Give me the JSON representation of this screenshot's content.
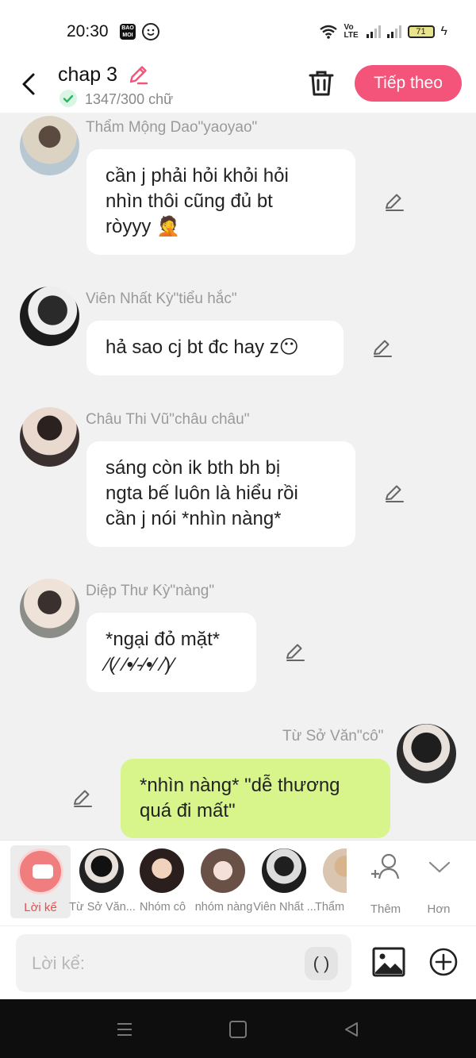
{
  "status_bar": {
    "time": "20:30",
    "battery": "71",
    "baomoi_text": "BAO MOI",
    "volte": "Vo LTE"
  },
  "header": {
    "title": "chap 3",
    "word_count": "1347/300 chữ",
    "next_label": "Tiếp theo",
    "accent_color": "#f4537a"
  },
  "messages": [
    {
      "sender": "Thẩm Mộng Dao\"yaoyao\"",
      "lines": [
        "cần j phải hỏi khỏi hỏi",
        "nhìn thôi cũng đủ bt",
        "ròyyy 🤦"
      ],
      "side": "left"
    },
    {
      "sender": "Viên Nhất Kỳ\"tiểu hắc\"",
      "lines": [
        "hả sao cj bt đc hay z😶"
      ],
      "side": "left"
    },
    {
      "sender": "Châu Thi Vũ\"châu châu\"",
      "lines": [
        "sáng còn ik bth bh bị",
        "ngta bế luôn là hiểu rồi",
        "cần j nói *nhìn nàng*"
      ],
      "side": "left"
    },
    {
      "sender": "Diệp Thư Kỳ\"nàng\"",
      "lines": [
        "*ngại đỏ mặt*",
        "⁄(⁄ ⁄•⁄-⁄•⁄ ⁄)⁄"
      ],
      "side": "left"
    },
    {
      "sender": "Từ Sở Văn\"cô\"",
      "lines": [
        "*nhìn nàng* \"dễ thương",
        "quá đi mất\""
      ],
      "side": "right"
    }
  ],
  "character_bar": {
    "narration_label": "Lời kể",
    "characters": [
      "Từ Sở Văn...",
      "Nhóm cô",
      "nhóm nàng",
      "Viên Nhất ...",
      "Thẩm"
    ],
    "add_label": "Thêm",
    "more_label": "Hơn"
  },
  "input": {
    "placeholder": "Lời kể:",
    "paren_label": "( )"
  }
}
